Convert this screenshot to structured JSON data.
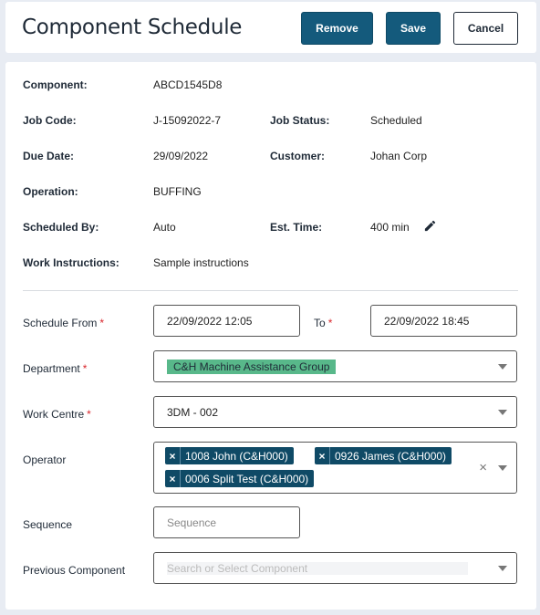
{
  "header": {
    "title": "Component Schedule",
    "remove_label": "Remove",
    "save_label": "Save",
    "cancel_label": "Cancel"
  },
  "details": {
    "component_label": "Component:",
    "component_value": "ABCD1545D8",
    "job_code_label": "Job Code:",
    "job_code_value": "J-15092022-7",
    "job_status_label": "Job Status:",
    "job_status_value": "Scheduled",
    "due_date_label": "Due Date:",
    "due_date_value": "29/09/2022",
    "customer_label": "Customer:",
    "customer_value": "Johan Corp",
    "operation_label": "Operation:",
    "operation_value": "BUFFING",
    "scheduled_by_label": "Scheduled By:",
    "scheduled_by_value": "Auto",
    "est_time_label": "Est. Time:",
    "est_time_value": "400 min",
    "work_instructions_label": "Work Instructions:",
    "work_instructions_value": "Sample instructions"
  },
  "form": {
    "required_mark": "*",
    "schedule_from_label": "Schedule From",
    "schedule_from_value": "22/09/2022 12:05",
    "to_label": "To",
    "to_value": "22/09/2022 18:45",
    "department_label": "Department",
    "department_value": "C&H Machine Assistance Group",
    "work_centre_label": "Work Centre",
    "work_centre_value": "3DM - 002",
    "operator_label": "Operator",
    "operators": [
      "1008 John (C&H000)",
      "0926 James (C&H000)",
      "0006 Split Test (C&H000)"
    ],
    "chip_remove": "×",
    "clear_all": "×",
    "sequence_label": "Sequence",
    "sequence_placeholder": "Sequence",
    "previous_component_label": "Previous Component",
    "previous_component_placeholder": "Search or Select Component"
  },
  "colors": {
    "primary": "#145a7c",
    "chip": "#0f4a66",
    "highlight": "#58b88a",
    "required": "#d9262c",
    "background": "#e8ecf3"
  },
  "icons": {
    "edit": "pencil-icon",
    "dropdown": "chevron-down-icon",
    "clear": "close-icon"
  }
}
